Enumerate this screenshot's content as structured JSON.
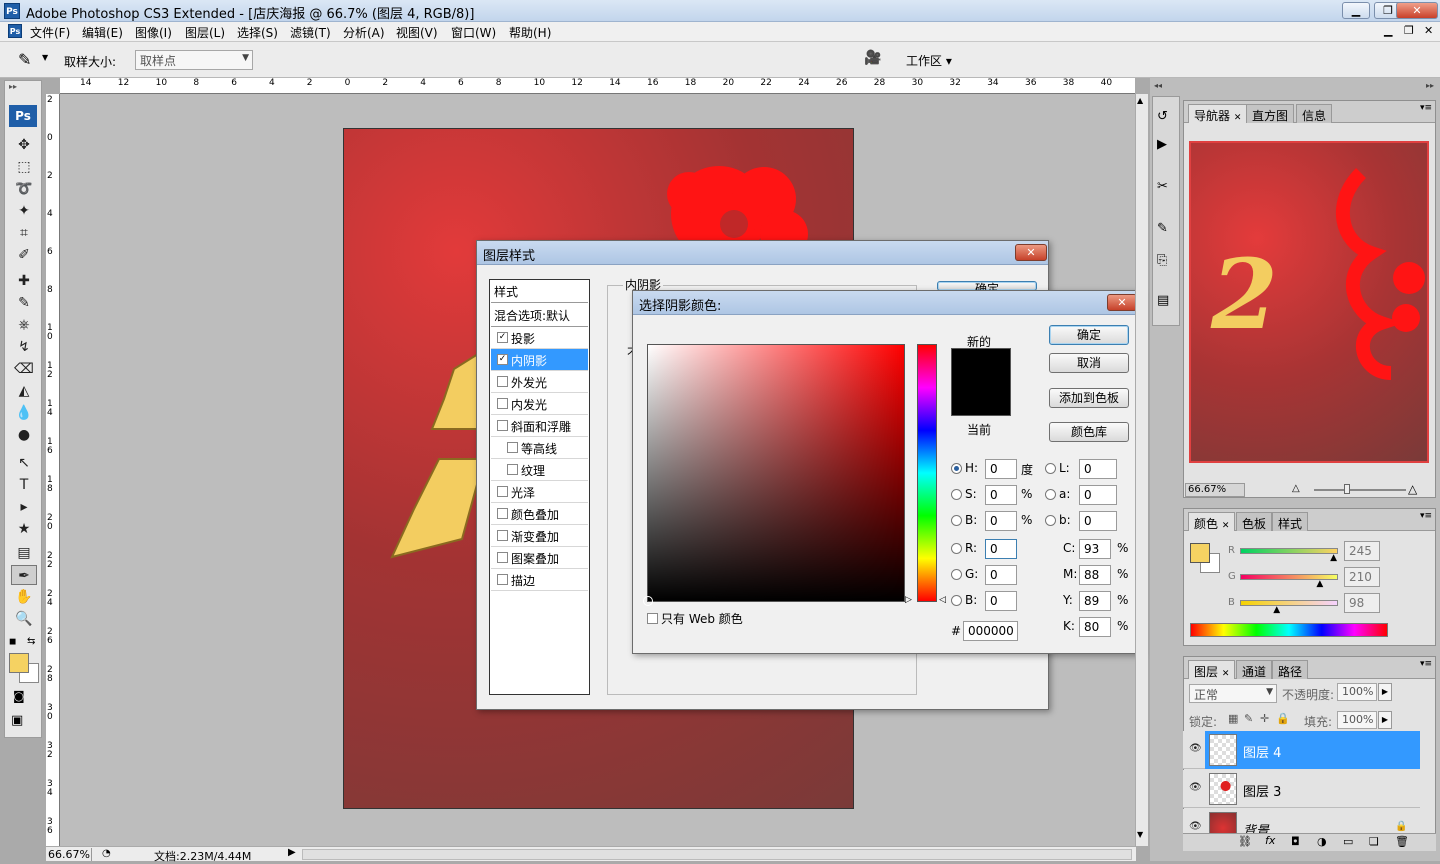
{
  "app": {
    "title": "Adobe Photoshop CS3 Extended - [店庆海报 @ 66.7% (图层 4, RGB/8)]",
    "icon": "ps-app-icon"
  },
  "menu": [
    "文件(F)",
    "编辑(E)",
    "图像(I)",
    "图层(L)",
    "选择(S)",
    "滤镜(T)",
    "分析(A)",
    "视图(V)",
    "窗口(W)",
    "帮助(H)"
  ],
  "options": {
    "sample_size_label": "取样大小:",
    "sample_size_value": "取样点",
    "workspace_label": "工作区 ▾"
  },
  "ruler": {
    "h_ticks": [
      "14",
      "12",
      "10",
      "8",
      "6",
      "4",
      "2",
      "0",
      "2",
      "4",
      "6",
      "8",
      "10",
      "12",
      "14",
      "16",
      "18",
      "20",
      "22",
      "24",
      "26",
      "28",
      "30",
      "32",
      "34",
      "36",
      "38",
      "40"
    ],
    "v_ticks": [
      "2",
      "0",
      "2",
      "4",
      "6",
      "8",
      "1 0",
      "1 2",
      "1 4",
      "1 6",
      "1 8",
      "2 0",
      "2 2",
      "2 4",
      "2 6",
      "2 8",
      "3 0",
      "3 2",
      "3 4",
      "3 6"
    ]
  },
  "status": {
    "zoom": "66.67%",
    "doc": "文档:2.23M/4.44M"
  },
  "navigator": {
    "tabs": [
      "导航器",
      "直方图",
      "信息"
    ],
    "zoom": "66.67%",
    "poster_text": "2"
  },
  "color_panel": {
    "tabs": [
      "颜色",
      "色板",
      "样式"
    ],
    "channels": [
      {
        "label": "R",
        "value": "245",
        "pos": 0.96
      },
      {
        "label": "G",
        "value": "210",
        "pos": 0.82
      },
      {
        "label": "B",
        "value": "98",
        "pos": 0.38
      }
    ],
    "fg": "#f5d262"
  },
  "layers": {
    "tabs": [
      "图层",
      "通道",
      "路径"
    ],
    "blend": "正常",
    "opacity_label": "不透明度:",
    "opacity": "100%",
    "lock_label": "锁定:",
    "fill_label": "填充:",
    "fill": "100%",
    "items": [
      {
        "name": "图层 4",
        "selected": true
      },
      {
        "name": "图层 3",
        "selected": false
      },
      {
        "name": "背景",
        "selected": false
      }
    ]
  },
  "layer_style": {
    "title": "图层样式",
    "styles_header": "样式",
    "blend_default": "混合选项:默认",
    "section": "内阴影",
    "ok_partial": "确定",
    "items": [
      {
        "label": "投影",
        "checked": true
      },
      {
        "label": "内阴影",
        "checked": true,
        "selected": true
      },
      {
        "label": "外发光",
        "checked": false
      },
      {
        "label": "内发光",
        "checked": false
      },
      {
        "label": "斜面和浮雕",
        "checked": false
      },
      {
        "label": "等高线",
        "checked": false,
        "sub": true
      },
      {
        "label": "纹理",
        "checked": false,
        "sub": true
      },
      {
        "label": "光泽",
        "checked": false
      },
      {
        "label": "颜色叠加",
        "checked": false
      },
      {
        "label": "渐变叠加",
        "checked": false
      },
      {
        "label": "图案叠加",
        "checked": false
      },
      {
        "label": "描边",
        "checked": false
      }
    ],
    "partial_label": "不"
  },
  "picker": {
    "title": "选择阴影颜色:",
    "new_label": "新的",
    "current_label": "当前",
    "buttons": {
      "ok": "确定",
      "cancel": "取消",
      "add": "添加到色板",
      "library": "颜色库"
    },
    "hsb": [
      {
        "l": "H:",
        "v": "0",
        "u": "度",
        "on": true
      },
      {
        "l": "S:",
        "v": "0",
        "u": "%",
        "on": false
      },
      {
        "l": "B:",
        "v": "0",
        "u": "%",
        "on": false
      }
    ],
    "rgb": [
      {
        "l": "R:",
        "v": "0"
      },
      {
        "l": "G:",
        "v": "0"
      },
      {
        "l": "B:",
        "v": "0"
      }
    ],
    "lab": [
      {
        "l": "L:",
        "v": "0"
      },
      {
        "l": "a:",
        "v": "0"
      },
      {
        "l": "b:",
        "v": "0"
      }
    ],
    "cmyk": [
      {
        "l": "C:",
        "v": "93"
      },
      {
        "l": "M:",
        "v": "88"
      },
      {
        "l": "Y:",
        "v": "89"
      },
      {
        "l": "K:",
        "v": "80"
      }
    ],
    "pct": "%",
    "hex_label": "#",
    "hex": "000000",
    "web_only": "只有 Web 颜色",
    "swatch_new": "#000000",
    "swatch_current": "#000000"
  }
}
